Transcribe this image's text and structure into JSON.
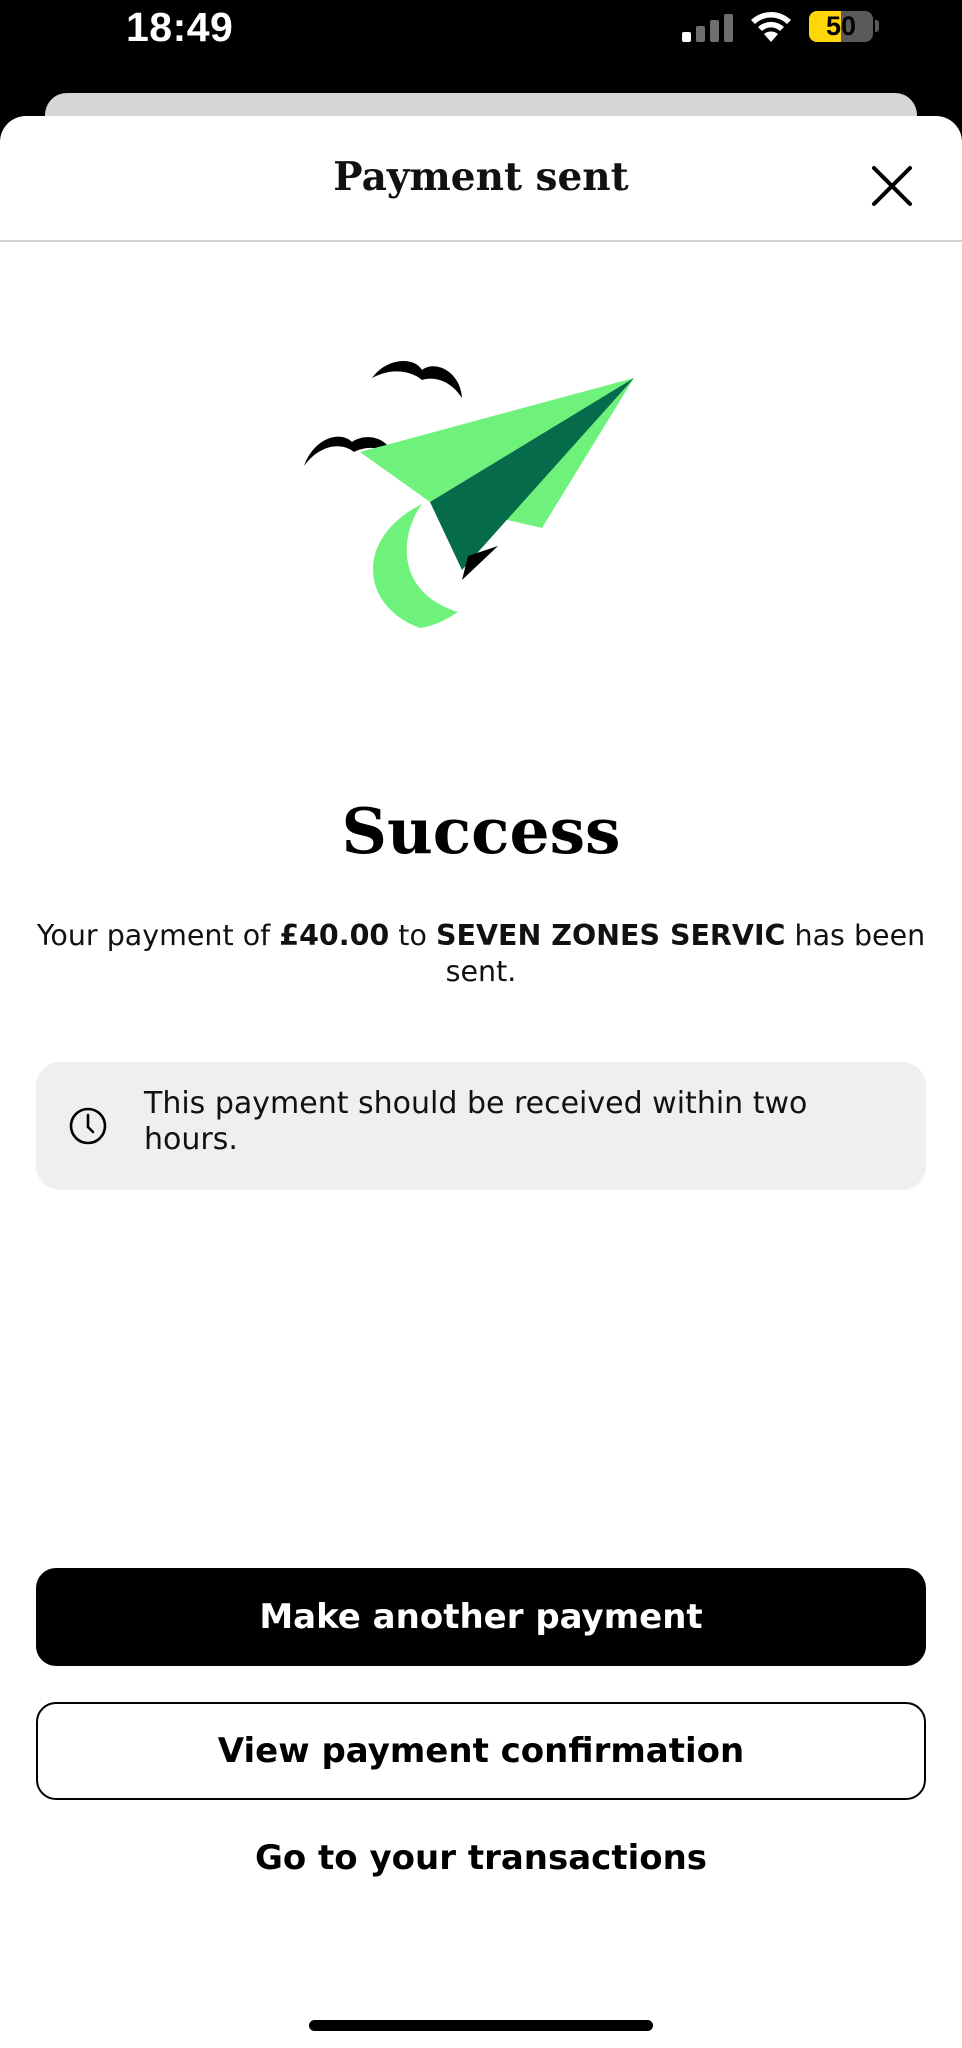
{
  "status_bar": {
    "time": "18:49",
    "battery_percent": "50",
    "battery_level": 0.5,
    "battery_color": "#ffd60a",
    "icons": [
      "signal-icon",
      "wifi-icon",
      "battery-icon"
    ]
  },
  "header": {
    "title": "Payment sent",
    "close_icon": "close-icon"
  },
  "illustration": {
    "name": "paper-plane-illustration",
    "colors": {
      "light_green": "#6ff27b",
      "dark_green": "#066b4a",
      "black": "#000000"
    }
  },
  "result": {
    "heading": "Success",
    "message_prefix": "Your payment of ",
    "amount": "£40.00",
    "message_middle": " to ",
    "payee": "SEVEN ZONES SERVIC",
    "message_suffix": " has been sent."
  },
  "info": {
    "icon": "clock-icon",
    "text": "This payment should be received within two hours."
  },
  "actions": {
    "primary_label": "Make another payment",
    "secondary_label": "View payment confirmation",
    "link_label": "Go to your transactions"
  }
}
